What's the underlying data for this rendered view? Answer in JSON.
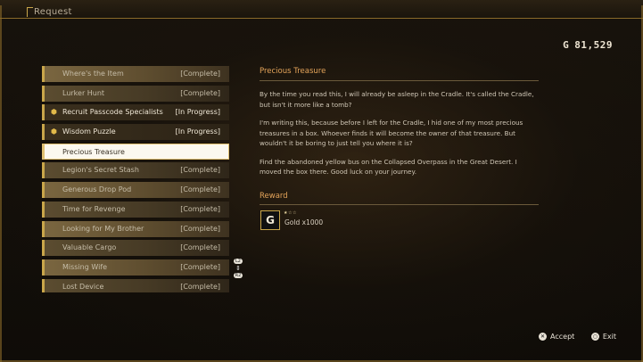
{
  "window": {
    "title": "Request"
  },
  "currency": {
    "symbol": "G",
    "amount": "81,529"
  },
  "quests": [
    {
      "name": "Where's the Item",
      "status": "[Complete]",
      "state": "complete"
    },
    {
      "name": "Lurker Hunt",
      "status": "[Complete]",
      "state": "complete"
    },
    {
      "name": "Recruit Passcode Specialists",
      "status": "[In Progress]",
      "state": "in-progress"
    },
    {
      "name": "Wisdom Puzzle",
      "status": "[In Progress]",
      "state": "in-progress"
    },
    {
      "name": "Precious Treasure",
      "status": "",
      "state": "selected"
    },
    {
      "name": "Legion's Secret Stash",
      "status": "[Complete]",
      "state": "complete"
    },
    {
      "name": "Generous Drop Pod",
      "status": "[Complete]",
      "state": "complete"
    },
    {
      "name": "Time for Revenge",
      "status": "[Complete]",
      "state": "complete"
    },
    {
      "name": "Looking for My Brother",
      "status": "[Complete]",
      "state": "complete"
    },
    {
      "name": "Valuable Cargo",
      "status": "[Complete]",
      "state": "complete"
    },
    {
      "name": "Missing Wife",
      "status": "[Complete]",
      "state": "complete"
    },
    {
      "name": "Lost Device",
      "status": "[Complete]",
      "state": "complete"
    }
  ],
  "detail": {
    "title": "Precious Treasure",
    "paragraphs": [
      "By the time you read this, I will already be asleep in the Cradle. It's called the Cradle, but isn't it more like a tomb?",
      "I'm writing this, because before I left for the Cradle, I hid one of my most precious treasures in a box. Whoever finds it will become the owner of that treasure. But wouldn't it be boring to just tell you where it is?",
      "Find the abandoned yellow bus on the Collapsed Overpass in the Great Desert. I moved the box there. Good luck on your journey."
    ],
    "reward_heading": "Reward",
    "reward": {
      "icon_letter": "G",
      "stars": "★☆☆",
      "label": "Gold x1000"
    }
  },
  "scroll_hint": {
    "up": "L2",
    "down": "R2"
  },
  "footer": {
    "accept": {
      "button": "✕",
      "label": "Accept"
    },
    "exit": {
      "button": "○",
      "label": "Exit"
    }
  },
  "colors": {
    "accent": "#e4a45a",
    "gold": "#c9a64a",
    "selected_bg": "#fbf8ef"
  }
}
